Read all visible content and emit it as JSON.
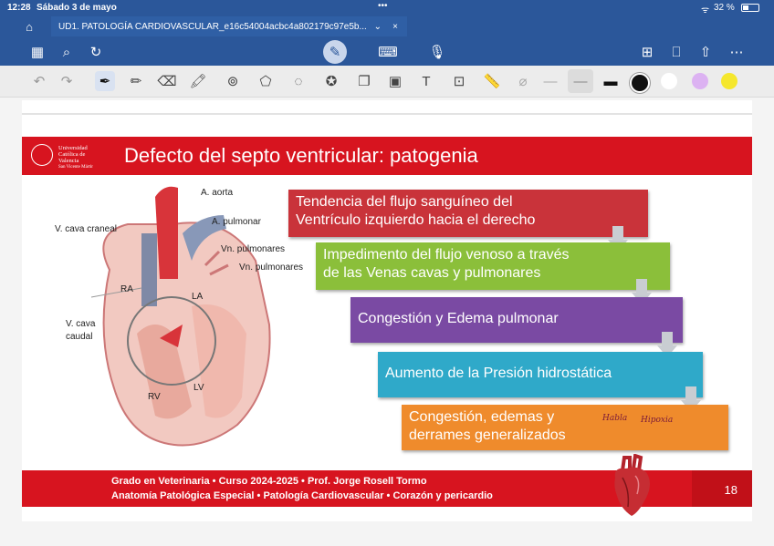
{
  "status": {
    "time": "12:28",
    "date": "Sábado 3 de mayo",
    "dots": "•••",
    "battery": "32 %"
  },
  "tab": {
    "title": "UD1. PATOLOGÍA CARDIOVASCULAR_e16c54004acbc4a802179c97e5b..."
  },
  "slide": {
    "logo": [
      "Universidad",
      "Católica de",
      "Valencia",
      "San Vicente Mártir"
    ],
    "title": "Defecto del septo ventricular: patogenia",
    "labels": {
      "aorta": "A. aorta",
      "pulmonar": "A. pulmonar",
      "vn1": "Vn. pulmonares",
      "vn2": "Vn. pulmonares",
      "cava_craneal": "V. cava craneal",
      "cava_caudal_1": "V. cava",
      "cava_caudal_2": "caudal",
      "ra": "RA",
      "la": "LA",
      "rv": "RV",
      "lv": "LV"
    },
    "boxes": [
      {
        "line1": "Tendencia del flujo sanguíneo del",
        "line2": "Ventrículo izquierdo hacia el derecho",
        "color": "#c9333a"
      },
      {
        "line1": "Impedimento del flujo venoso a través",
        "line2": "de las Venas cavas y pulmonares",
        "color": "#8bbf3a"
      },
      {
        "line1": "Congestión y Edema pulmonar",
        "line2": "",
        "color": "#7a4aa3"
      },
      {
        "line1": "Aumento de la Presión hidrostática",
        "line2": "",
        "color": "#2fa9c9"
      },
      {
        "line1": "Congestión, edemas y",
        "line2": "derrames generalizados",
        "color": "#ef8b2c"
      }
    ],
    "handwriting": [
      "Habla",
      "Hipoxia"
    ],
    "footer_line1": "Grado en Veterinaria • Curso 2024-2025 • Prof. Jorge Rosell Tormo",
    "footer_line2": "Anatomía Patológica Especial • Patología Cardiovascular • Corazón y pericardio",
    "page_number": "18"
  },
  "colors": {
    "app_blue": "#2b579a",
    "slide_red": "#d7141f"
  },
  "toolbar_icons": [
    "undo-icon",
    "redo-icon",
    "pen-icon",
    "pencil-icon",
    "eraser-icon",
    "highlighter-icon",
    "zoom-pen-icon",
    "shape-icon",
    "lasso-icon",
    "sticker-icon",
    "copy-icon",
    "image-icon",
    "text-icon",
    "photo-icon",
    "ruler-icon",
    "paint-icon",
    "thin-line-icon",
    "medium-line-icon",
    "thick-line-icon",
    "black-color",
    "white-color",
    "lilac-color",
    "yellow-color"
  ]
}
